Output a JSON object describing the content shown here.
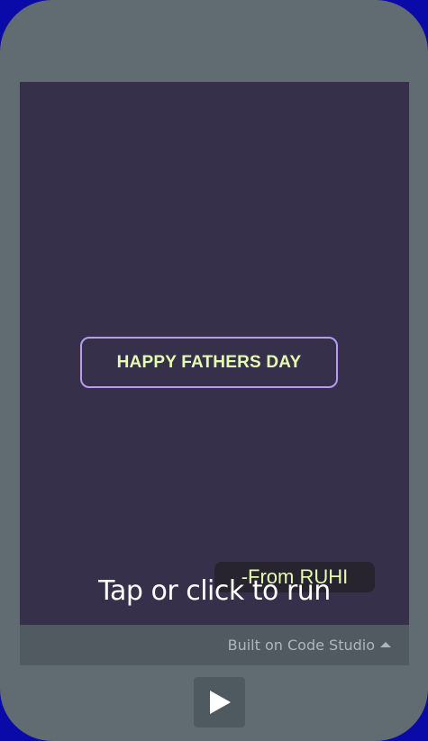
{
  "app": {
    "title_label": "HAPPY FATHERS DAY",
    "from_label": "-From RUHI",
    "overlay_label": "Tap or click to run"
  },
  "footer": {
    "built_on_label": "Built on Code Studio",
    "caret_icon": "caret-up-icon"
  },
  "controls": {
    "play_icon": "play-icon"
  },
  "colors": {
    "outer_background": "#0a0aa8",
    "phone_body": "#606b72",
    "screen_background": "#36304b",
    "title_text": "#e4fbb0",
    "title_border": "#b89cf2",
    "from_box_background": "#27232f",
    "footer_bar": "#515a61",
    "footer_text": "#aeb6bb"
  }
}
